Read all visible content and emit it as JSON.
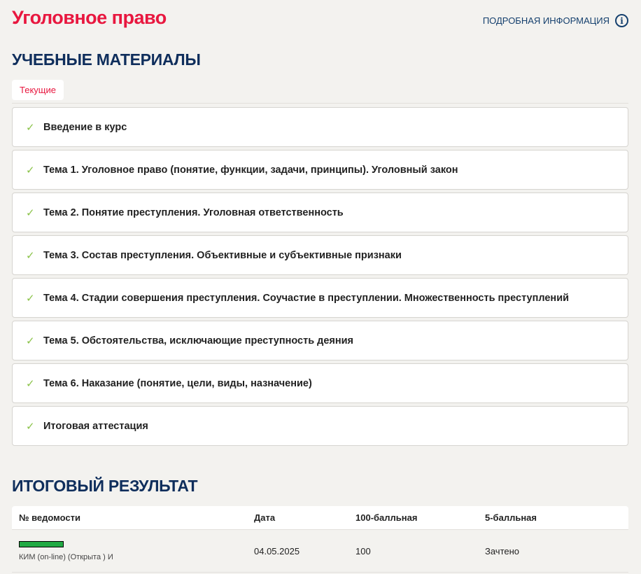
{
  "header": {
    "title": "Уголовное право",
    "info_link": "ПОДРОБНАЯ ИНФОРМАЦИЯ",
    "info_icon": "i"
  },
  "materials": {
    "heading": "УЧЕБНЫЕ МАТЕРИАЛЫ",
    "tab": "Текущие",
    "check_icon": "✓",
    "items": [
      "Введение в курс",
      "Тема 1. Уголовное право (понятие, функции, задачи, принципы). Уголовный закон",
      "Тема 2. Понятие преступления. Уголовная ответственность",
      "Тема 3. Состав преступления. Объективные и субъективные признаки",
      "Тема 4. Стадии совершения преступления. Соучастие в преступлении. Множественность преступлений",
      "Тема 5. Обстоятельства, исключающие преступность деяния",
      "Тема 6. Наказание (понятие, цели, виды, назначение)",
      "Итоговая аттестация"
    ]
  },
  "results": {
    "heading": "ИТОГОВЫЙ РЕЗУЛЬТАТ",
    "columns": [
      "№ ведомости",
      "Дата",
      "100-балльная",
      "5-балльная"
    ],
    "rows": [
      {
        "sheet": "КИМ (on-line) (Открыта ) И",
        "date": "04.05.2025",
        "score100": "100",
        "score5": "Зачтено",
        "progress": 1.0
      }
    ]
  },
  "colors": {
    "accent": "#e8173f",
    "heading": "#0f2e5c",
    "check": "#8bc34a",
    "bar": "#22aa44"
  }
}
